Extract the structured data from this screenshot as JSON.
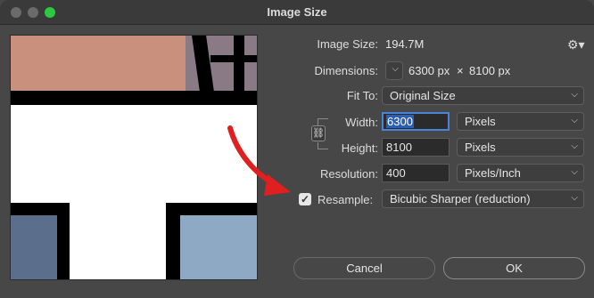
{
  "window": {
    "title": "Image Size"
  },
  "image_size": {
    "label": "Image Size:",
    "value": "194.7M"
  },
  "dimensions": {
    "label": "Dimensions:",
    "width": "6300 px",
    "separator": "×",
    "height": "8100 px",
    "toggle_icon": "chevron-down-icon"
  },
  "fit_to": {
    "label": "Fit To:",
    "value": "Original Size"
  },
  "width": {
    "label": "Width:",
    "value": "6300",
    "unit": "Pixels"
  },
  "height": {
    "label": "Height:",
    "value": "8100",
    "unit": "Pixels"
  },
  "resolution": {
    "label": "Resolution:",
    "value": "400",
    "unit": "Pixels/Inch"
  },
  "resample": {
    "label": "Resample:",
    "checked": true,
    "value": "Bicubic Sharper (reduction)"
  },
  "buttons": {
    "cancel": "Cancel",
    "ok": "OK"
  },
  "icons": {
    "settings": "gear-icon",
    "link": "link-icon",
    "annotation": "red-arrow"
  },
  "colors": {
    "background": "#474747",
    "accent": "#4a84d8",
    "zoom_button": "#2bc840",
    "annotation": "#e02020"
  }
}
